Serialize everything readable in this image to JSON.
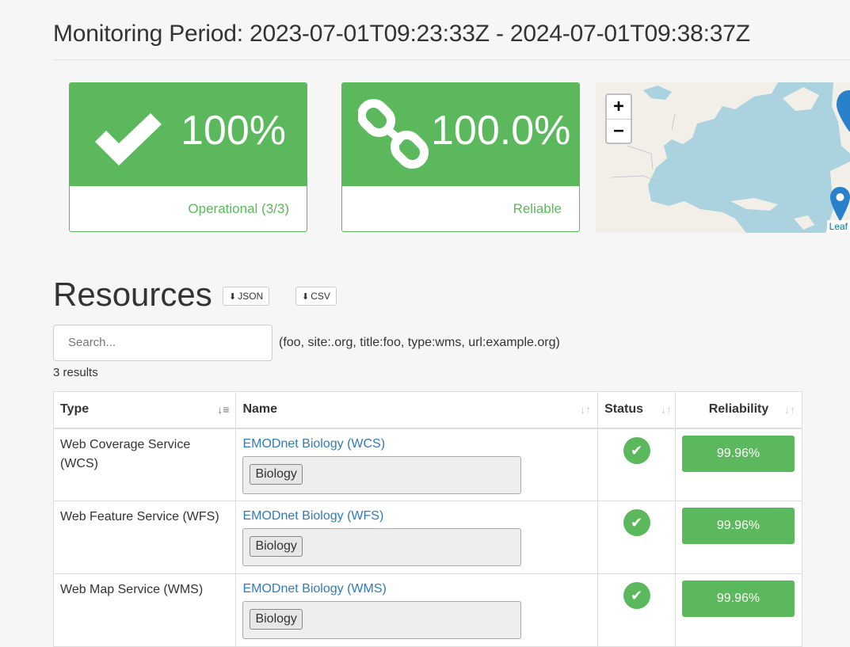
{
  "header": {
    "period_label": "Monitoring Period: 2023-07-01T09:23:33Z - 2024-07-01T09:38:37Z"
  },
  "stats": {
    "operational": {
      "value": "100%",
      "label": "Operational (3/3)",
      "icon": "check-icon"
    },
    "reliable": {
      "value": "100.0%",
      "label": "Reliable",
      "icon": "link-icon"
    }
  },
  "map": {
    "zoom_in": "+",
    "zoom_out": "−",
    "attribution": "Leaf"
  },
  "resources": {
    "title": "Resources",
    "json_button": "JSON",
    "csv_button": "CSV",
    "search_placeholder": "Search...",
    "search_hint": "(foo, site:.org, title:foo, type:wms, url:example.org)",
    "results_count": "3 results"
  },
  "table": {
    "headers": {
      "type": "Type",
      "name": "Name",
      "status": "Status",
      "reliability": "Reliability"
    },
    "rows": [
      {
        "type": "Web Coverage Service (WCS)",
        "name": "EMODnet Biology (WCS)",
        "tag": "Biology",
        "status": "ok",
        "reliability": "99.96%"
      },
      {
        "type": "Web Feature Service (WFS)",
        "name": "EMODnet Biology (WFS)",
        "tag": "Biology",
        "status": "ok",
        "reliability": "99.96%"
      },
      {
        "type": "Web Map Service (WMS)",
        "name": "EMODnet Biology (WMS)",
        "tag": "Biology",
        "status": "ok",
        "reliability": "99.96%"
      }
    ]
  },
  "colors": {
    "success": "#5cb85c",
    "link": "#337ab7"
  }
}
